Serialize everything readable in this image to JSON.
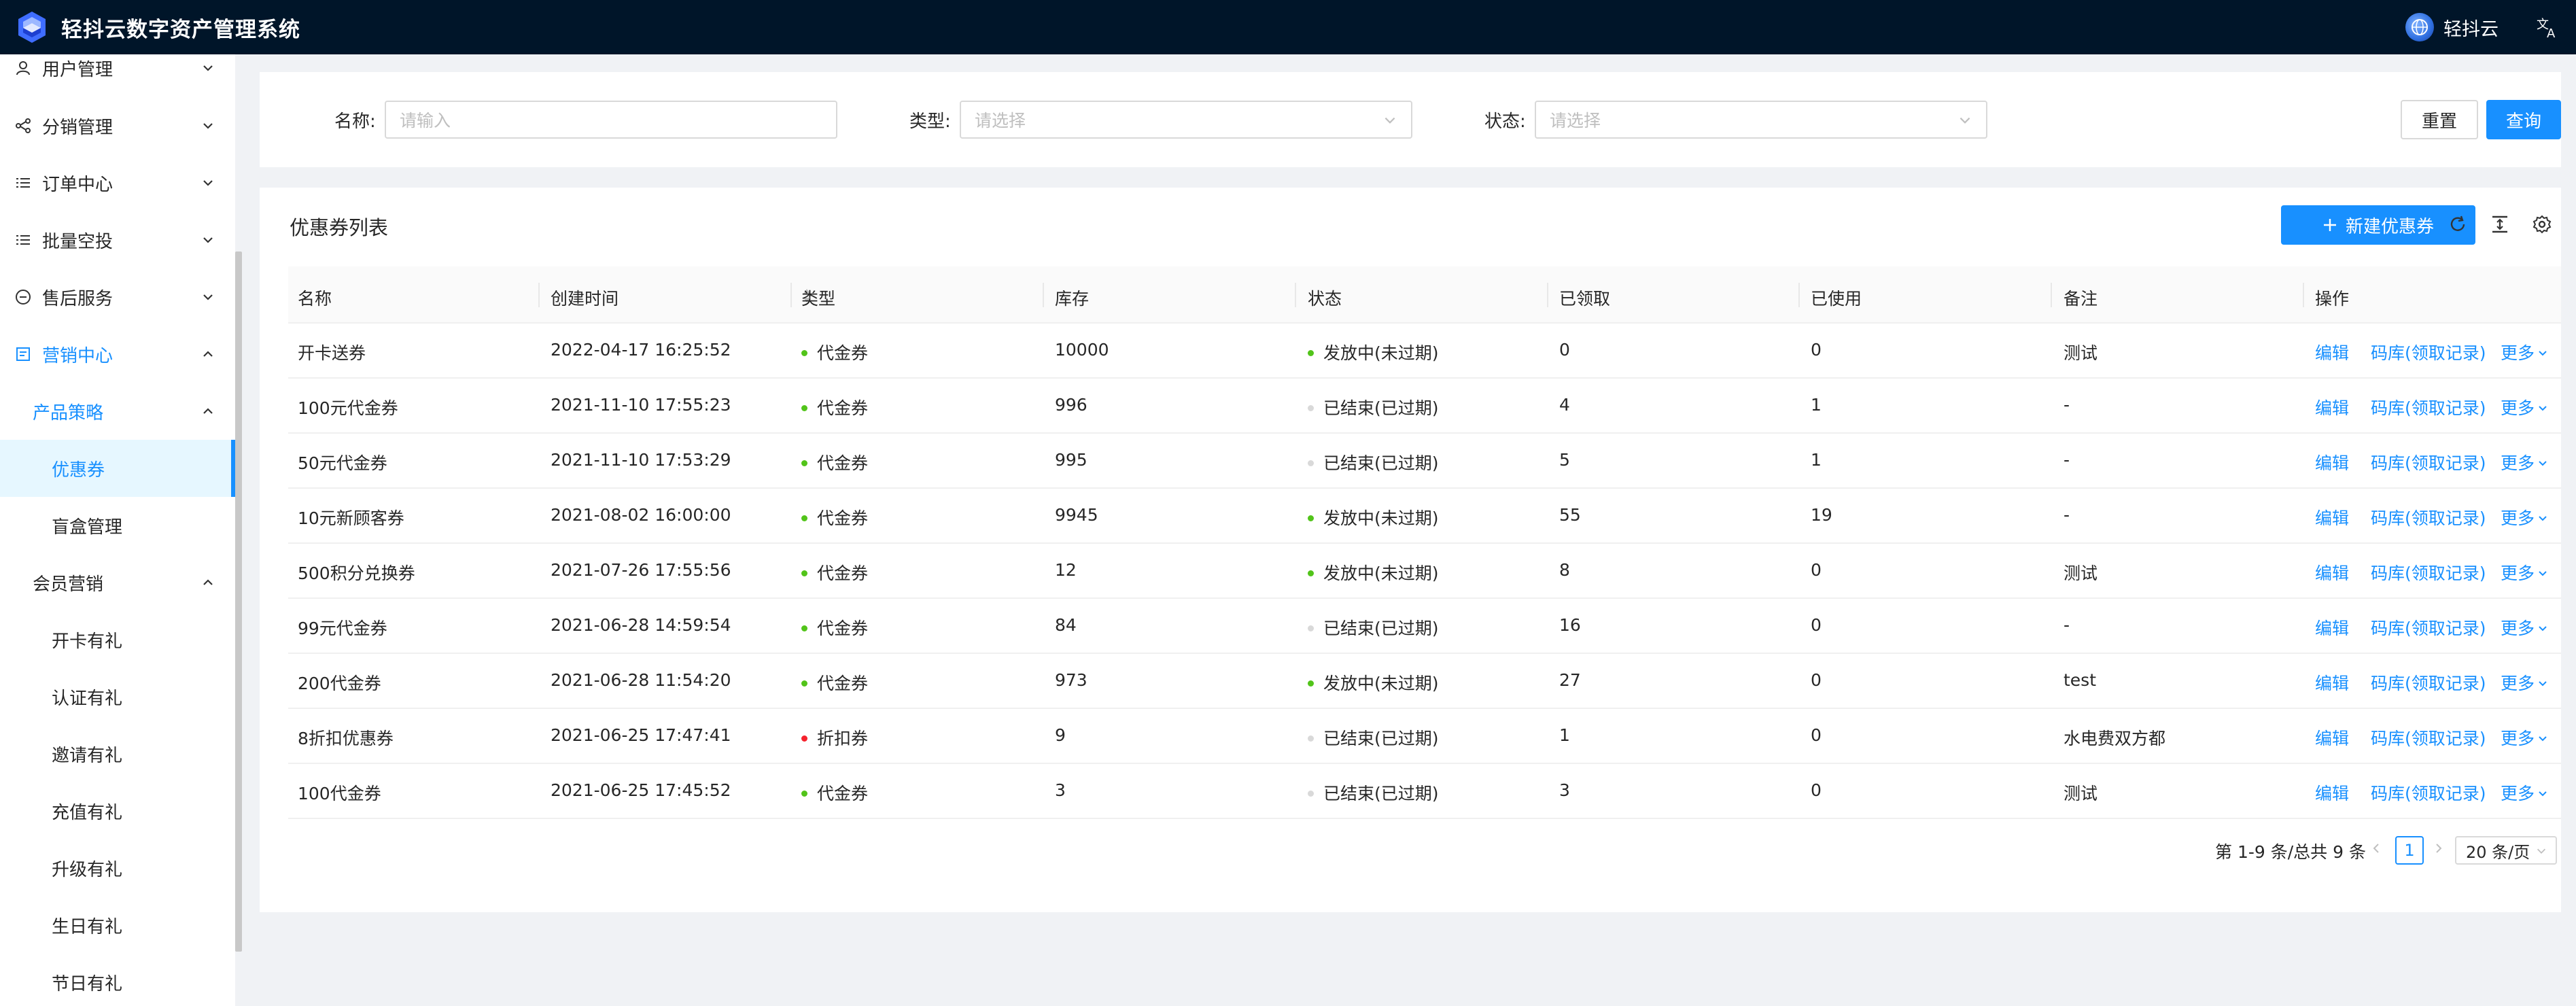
{
  "header": {
    "title": "轻抖云数字资产管理系统",
    "user_name": "轻抖云",
    "icons": {
      "logo": "logo-icon",
      "avatar": "avatar",
      "language": "translate-icon"
    }
  },
  "sidebar": {
    "items": [
      {
        "label": "用户管理",
        "icon": "user-icon"
      },
      {
        "label": "分销管理",
        "icon": "share-icon"
      },
      {
        "label": "订单中心",
        "icon": "list-icon"
      },
      {
        "label": "批量空投",
        "icon": "list-icon"
      },
      {
        "label": "售后服务",
        "icon": "service-icon"
      },
      {
        "label": "营销中心",
        "icon": "marketing-icon"
      }
    ],
    "submenu": {
      "product_strategy": "产品策略",
      "coupon": "优惠券",
      "blind_box": "盲盒管理",
      "member_marketing": "会员营销",
      "member_items": [
        "开卡有礼",
        "认证有礼",
        "邀请有礼",
        "充值有礼",
        "升级有礼",
        "生日有礼",
        "节日有礼"
      ]
    }
  },
  "search": {
    "name_label": "名称:",
    "name_placeholder": "请输入",
    "type_label": "类型:",
    "type_placeholder": "请选择",
    "status_label": "状态:",
    "status_placeholder": "请选择",
    "reset_label": "重置",
    "query_label": "查询"
  },
  "table": {
    "title": "优惠券列表",
    "new_button": "新建优惠券",
    "columns": [
      "名称",
      "创建时间",
      "类型",
      "库存",
      "状态",
      "已领取",
      "已使用",
      "备注",
      "操作"
    ],
    "action_edit": "编辑",
    "action_codes": "码库(领取记录)",
    "action_more": "更多",
    "colors": {
      "green": "#52c41a",
      "gray": "#d9d9d9",
      "red": "#f5222d",
      "link": "#1890ff"
    },
    "rows": [
      {
        "name": "开卡送券",
        "created": "2022-04-17 16:25:52",
        "type": "代金券",
        "type_color": "green",
        "stock": "10000",
        "status": "发放中(未过期)",
        "status_color": "green",
        "claimed": "0",
        "used": "0",
        "remark": "测试"
      },
      {
        "name": "100元代金券",
        "created": "2021-11-10 17:55:23",
        "type": "代金券",
        "type_color": "green",
        "stock": "996",
        "status": "已结束(已过期)",
        "status_color": "gray",
        "claimed": "4",
        "used": "1",
        "remark": "-"
      },
      {
        "name": "50元代金券",
        "created": "2021-11-10 17:53:29",
        "type": "代金券",
        "type_color": "green",
        "stock": "995",
        "status": "已结束(已过期)",
        "status_color": "gray",
        "claimed": "5",
        "used": "1",
        "remark": "-"
      },
      {
        "name": "10元新顾客券",
        "created": "2021-08-02 16:00:00",
        "type": "代金券",
        "type_color": "green",
        "stock": "9945",
        "status": "发放中(未过期)",
        "status_color": "green",
        "claimed": "55",
        "used": "19",
        "remark": "-"
      },
      {
        "name": "500积分兑换券",
        "created": "2021-07-26 17:55:56",
        "type": "代金券",
        "type_color": "green",
        "stock": "12",
        "status": "发放中(未过期)",
        "status_color": "green",
        "claimed": "8",
        "used": "0",
        "remark": "测试"
      },
      {
        "name": "99元代金券",
        "created": "2021-06-28 14:59:54",
        "type": "代金券",
        "type_color": "green",
        "stock": "84",
        "status": "已结束(已过期)",
        "status_color": "gray",
        "claimed": "16",
        "used": "0",
        "remark": "-"
      },
      {
        "name": "200代金券",
        "created": "2021-06-28 11:54:20",
        "type": "代金券",
        "type_color": "green",
        "stock": "973",
        "status": "发放中(未过期)",
        "status_color": "green",
        "claimed": "27",
        "used": "0",
        "remark": "test"
      },
      {
        "name": "8折扣优惠券",
        "created": "2021-06-25 17:47:41",
        "type": "折扣券",
        "type_color": "red",
        "stock": "9",
        "status": "已结束(已过期)",
        "status_color": "gray",
        "claimed": "1",
        "used": "0",
        "remark": "水电费双方都"
      },
      {
        "name": "100代金券",
        "created": "2021-06-25 17:45:52",
        "type": "代金券",
        "type_color": "green",
        "stock": "3",
        "status": "已结束(已过期)",
        "status_color": "gray",
        "claimed": "3",
        "used": "0",
        "remark": "测试"
      }
    ]
  },
  "pagination": {
    "total_text": "第 1-9 条/总共 9 条",
    "current_page": "1",
    "page_size": "20 条/页"
  }
}
